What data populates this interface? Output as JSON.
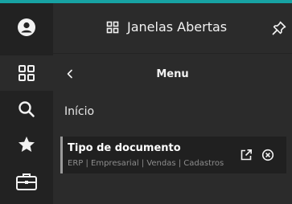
{
  "header": {
    "title": "Janelas Abertas"
  },
  "menu": {
    "title": "Menu"
  },
  "home": {
    "label": "Início"
  },
  "open_window": {
    "title": "Tipo de documento",
    "path": "ERP | Empresarial | Vendas | Cadastros"
  },
  "rail": {
    "items": [
      "user-icon",
      "grid-icon",
      "search-icon",
      "star-icon",
      "briefcase-icon"
    ],
    "active": "grid-icon"
  },
  "colors": {
    "accent": "#17a2a3",
    "rail_bg": "#222222",
    "main_bg": "#2b2b2b",
    "card_bg": "#202020"
  }
}
